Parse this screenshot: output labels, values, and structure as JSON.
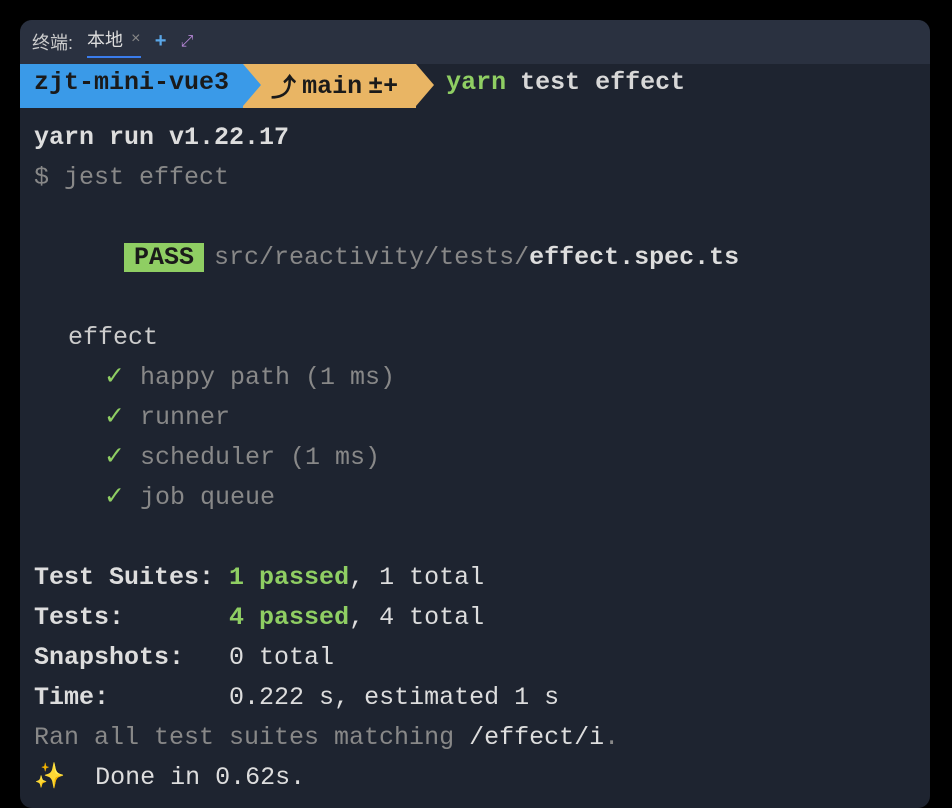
{
  "tabbar": {
    "label": "终端:",
    "tabName": "本地",
    "close": "×",
    "add": "+",
    "expand": "⤢"
  },
  "prompt": {
    "cwd": "zjt-mini-vue3",
    "branchIcon": "⤴",
    "branch": "main",
    "gitStatus": "±+",
    "cmd": "yarn",
    "args": "test effect"
  },
  "output": {
    "yarnVersion": "yarn run v1.22.17",
    "jestCmd": "$ jest effect",
    "passBadge": "PASS",
    "filePath": "src/reactivity/tests/",
    "fileName": "effect.spec.ts",
    "suiteName": "effect",
    "tests": [
      {
        "check": "✓",
        "name": "happy path (1 ms)"
      },
      {
        "check": "✓",
        "name": "runner"
      },
      {
        "check": "✓",
        "name": "scheduler (1 ms)"
      },
      {
        "check": "✓",
        "name": "job queue"
      }
    ],
    "summary": {
      "suitesLabel": "Test Suites: ",
      "suitesPassed": "1 passed",
      "suitesRest": ", 1 total",
      "testsLabel": "Tests:       ",
      "testsPassed": "4 passed",
      "testsRest": ", 4 total",
      "snapshotsLabel": "Snapshots:   ",
      "snapshotsValue": "0 total",
      "timeLabel": "Time:        ",
      "timeValue": "0.222 s, estimated 1 s"
    },
    "ranPrefix": "Ran all test suites matching ",
    "ranPattern": "/effect/i",
    "ranSuffix": ".",
    "sparkle": "✨",
    "done": "  Done in 0.62s."
  }
}
